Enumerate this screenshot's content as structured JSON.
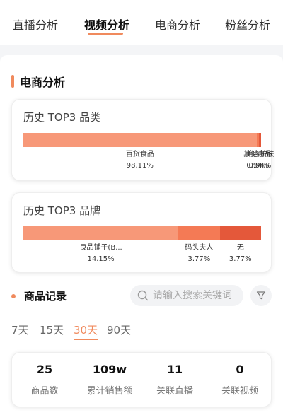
{
  "tabs": [
    {
      "label": "直播分析",
      "active": false
    },
    {
      "label": "视频分析",
      "active": true
    },
    {
      "label": "电商分析",
      "active": false
    },
    {
      "label": "粉丝分析",
      "active": false
    }
  ],
  "section": {
    "title": "电商分析"
  },
  "category_card": {
    "title": "历史 TOP3 品类",
    "segments": [
      {
        "name": "百货食品",
        "percent_text": "98.11%",
        "value": 98.11,
        "color": "#f79878"
      },
      {
        "name": "其他商品",
        "percent_text": "0.94%",
        "value": 0.94,
        "color": "#f47a55"
      },
      {
        "name": "美容护肤",
        "percent_text": "0.94%",
        "value": 0.94,
        "color": "#e4583a"
      }
    ]
  },
  "brand_card": {
    "title": "历史 TOP3 品牌",
    "segments": [
      {
        "name": "良品铺子(B...",
        "percent_text": "14.15%",
        "value": 14.15,
        "color": "#f79878"
      },
      {
        "name": "码头夫人",
        "percent_text": "3.77%",
        "value": 3.77,
        "color": "#f47a55"
      },
      {
        "name": "无",
        "percent_text": "3.77%",
        "value": 3.77,
        "color": "#e4583a"
      }
    ]
  },
  "records": {
    "title": "商品记录",
    "search_placeholder": "请输入搜索关键词"
  },
  "periods": [
    {
      "label": "7天",
      "active": false
    },
    {
      "label": "15天",
      "active": false
    },
    {
      "label": "30天",
      "active": true
    },
    {
      "label": "90天",
      "active": false
    }
  ],
  "stats": [
    {
      "value": "25",
      "label": "商品数"
    },
    {
      "value": "109w",
      "label": "累计销售额"
    },
    {
      "value": "11",
      "label": "关联直播"
    },
    {
      "value": "0",
      "label": "关联视频"
    }
  ],
  "colors": {
    "accent": "#f08a5d"
  }
}
